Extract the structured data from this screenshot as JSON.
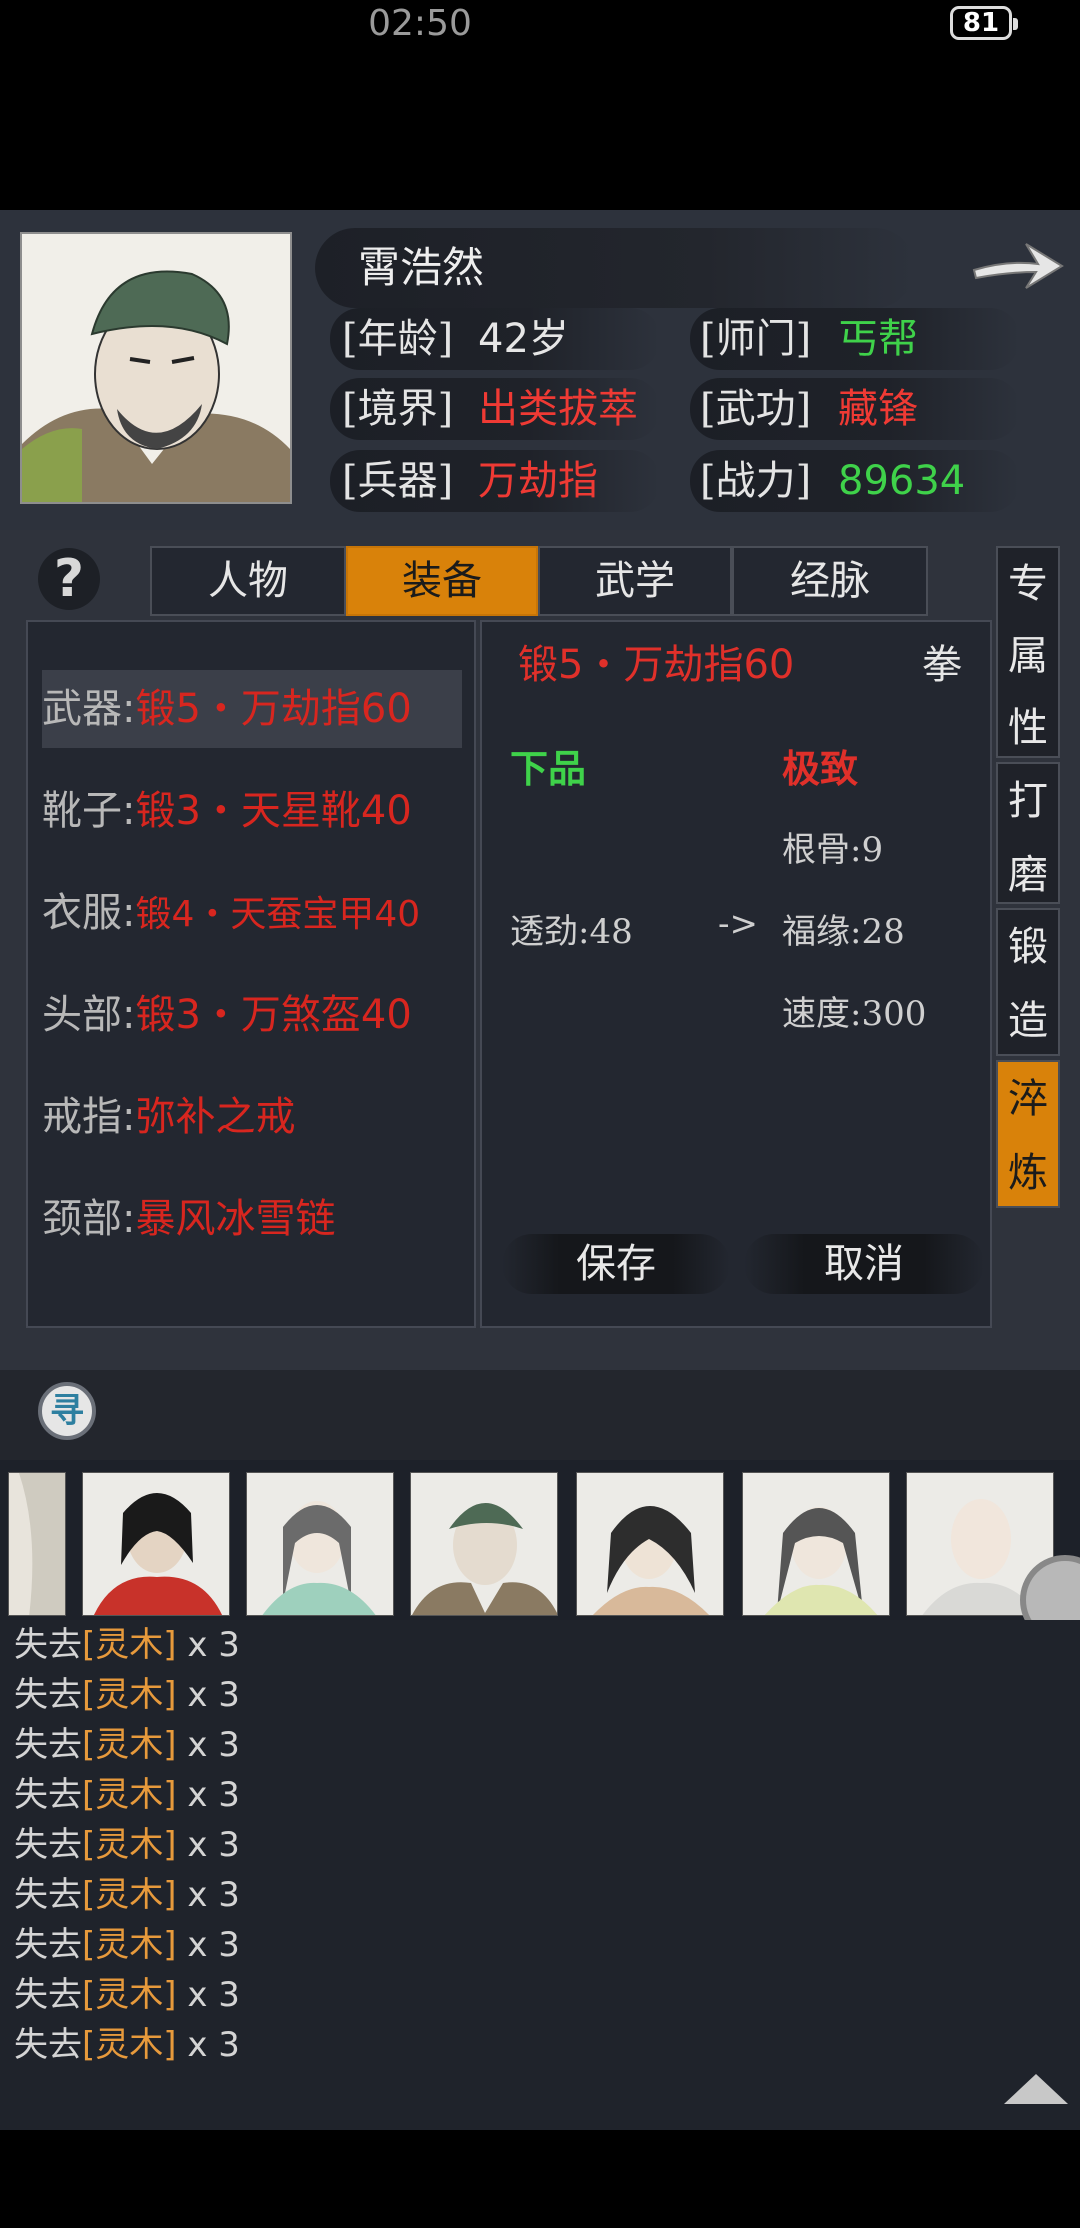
{
  "status": {
    "time": "02:50",
    "battery": "81"
  },
  "hero": {
    "name": "霄浩然",
    "age_label": "[年龄]",
    "age": "42岁",
    "sect_label": "[师门]",
    "sect": "丐帮",
    "realm_label": "[境界]",
    "realm": "出类拔萃",
    "martial_label": "[武功]",
    "martial": "藏锋",
    "weapon_label": "[兵器]",
    "weapon": "万劫指",
    "power_label": "[战力]",
    "power": "89634"
  },
  "tabs": {
    "help": "?",
    "character": "人物",
    "equipment": "装备",
    "martial": "武学",
    "meridian": "经脉"
  },
  "side_tabs": {
    "exclusive": [
      "专",
      "属",
      "性"
    ],
    "polish": [
      "打",
      "磨"
    ],
    "forge": [
      "锻",
      "造"
    ],
    "refine": [
      "淬",
      "炼"
    ]
  },
  "equipment": [
    {
      "slot": "武器:",
      "item": "锻5・万劫指60"
    },
    {
      "slot": "靴子:",
      "item": "锻3・天星靴40"
    },
    {
      "slot": "衣服:",
      "item": "锻4・天蚕宝甲40"
    },
    {
      "slot": "头部:",
      "item": "锻3・万煞盔40"
    },
    {
      "slot": "戒指:",
      "item": "弥补之戒"
    },
    {
      "slot": "颈部:",
      "item": "暴风冰雪链"
    }
  ],
  "detail": {
    "item_name": "锻5・万劫指60",
    "item_type": "拳",
    "grade_from": "下品",
    "grade_to": "极致",
    "attr_from": "透劲:48",
    "arrow": "->",
    "attr_to": [
      "根骨:9",
      "福缘:28",
      "速度:300"
    ],
    "save": "保存",
    "cancel": "取消"
  },
  "search_icon_glyph": "寻",
  "log": [
    {
      "prefix": "失去",
      "item": "[灵木]",
      "qty": " x 3"
    },
    {
      "prefix": "失去",
      "item": "[灵木]",
      "qty": " x 3"
    },
    {
      "prefix": "失去",
      "item": "[灵木]",
      "qty": " x 3"
    },
    {
      "prefix": "失去",
      "item": "[灵木]",
      "qty": " x 3"
    },
    {
      "prefix": "失去",
      "item": "[灵木]",
      "qty": " x 3"
    },
    {
      "prefix": "失去",
      "item": "[灵木]",
      "qty": " x 3"
    },
    {
      "prefix": "失去",
      "item": "[灵木]",
      "qty": " x 3"
    },
    {
      "prefix": "失去",
      "item": "[灵木]",
      "qty": " x 3"
    },
    {
      "prefix": "失去",
      "item": "[灵木]",
      "qty": " x 3"
    }
  ],
  "colors": {
    "accent": "#d9820a",
    "red": "#d8261f",
    "green": "#3fd24a",
    "log_item": "#e79a3c"
  }
}
